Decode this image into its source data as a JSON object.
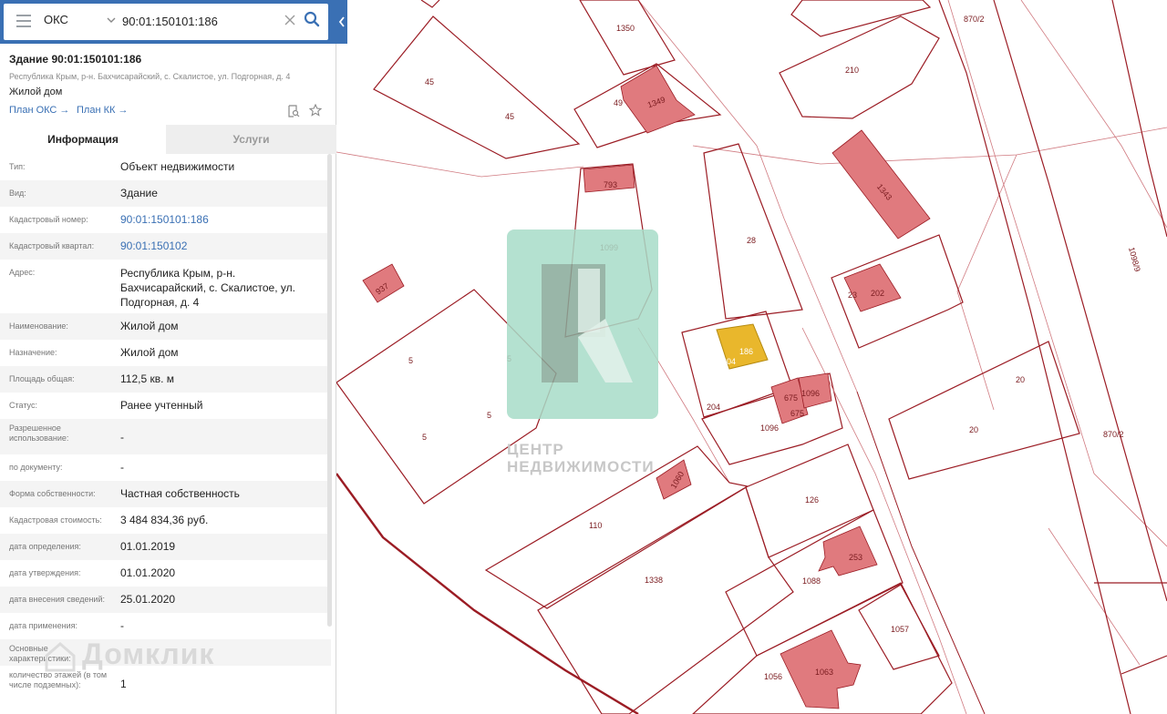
{
  "search": {
    "type_label": "ОКС",
    "query": "90:01:150101:186"
  },
  "object": {
    "title": "Здание 90:01:150101:186",
    "address": "Республика Крым, р-н. Бахчисарайский, с. Скалистое, ул. Подгорная, д. 4",
    "name": "Жилой дом",
    "plan_oks": "План ОКС →",
    "plan_kk": "План КК →"
  },
  "tabs": {
    "info": "Информация",
    "services": "Услуги"
  },
  "info_rows": [
    {
      "key": "Тип:",
      "value": "Объект недвижимости"
    },
    {
      "key": "Вид:",
      "value": "Здание"
    },
    {
      "key": "Кадастровый номер:",
      "value": "90:01:150101:186"
    },
    {
      "key": "Кадастровый квартал:",
      "value": "90:01:150102"
    },
    {
      "key": "Адрес:",
      "value": "Республика Крым, р-н. Бахчисарайский, с. Скалистое, ул. Подгорная, д. 4"
    },
    {
      "key": "Наименование:",
      "value": "Жилой дом"
    },
    {
      "key": "Назначение:",
      "value": "Жилой дом"
    },
    {
      "key": "Площадь общая:",
      "value": "112,5 кв. м"
    },
    {
      "key": "Статус:",
      "value": "Ранее учтенный"
    },
    {
      "key": "Разрешенное использование:",
      "value": "-"
    },
    {
      "key": "по документу:",
      "value": "-"
    },
    {
      "key": "Форма собственности:",
      "value": "Частная собственность"
    },
    {
      "key": "Кадастровая стоимость:",
      "value": "3 484 834,36 руб."
    },
    {
      "key": "дата определения:",
      "value": "01.01.2019"
    },
    {
      "key": "дата утверждения:",
      "value": "01.01.2020"
    },
    {
      "key": "дата внесения сведений:",
      "value": "25.01.2020"
    },
    {
      "key": "дата применения:",
      "value": "-"
    },
    {
      "key": "Основные характеристики:",
      "value": ""
    },
    {
      "key": "количество этажей (в том числе подземных):",
      "value": "1"
    }
  ],
  "watermark": {
    "line1": "ЦЕНТР",
    "line2": "НЕДВИЖИМОСТИ",
    "domklik": "Домклик"
  },
  "map_labels": {
    "p1350": "1350",
    "p870_2a": "870/2",
    "p45a": "45",
    "p45b": "45",
    "p49": "49",
    "p1349": "1349",
    "p210": "210",
    "p793": "793",
    "p1343": "1343",
    "p1098_9": "1098/9",
    "p28": "28",
    "p1099": "1099",
    "p937": "937",
    "p23": "23",
    "p202": "202",
    "p5a": "5",
    "p5b": "5",
    "p5c": "5",
    "p5d": "5",
    "p186": "186",
    "p204a": "204",
    "p204b": "204",
    "p675a": "675",
    "p675b": "675",
    "p1096a": "1096",
    "p1096b": "1096",
    "p20a": "20",
    "p20b": "20",
    "p870_2b": "870/2",
    "p1060": "1060",
    "p126": "126",
    "p110": "110",
    "p253": "253",
    "p1338": "1338",
    "p1088": "1088",
    "p1057": "1057",
    "p1063": "1063",
    "p1056": "1056"
  },
  "colors": {
    "header_blue": "#3a70b4",
    "parcel_line": "#9b1c24",
    "building_fill": "#e07a7e",
    "selected_fill": "#e9b72c"
  }
}
